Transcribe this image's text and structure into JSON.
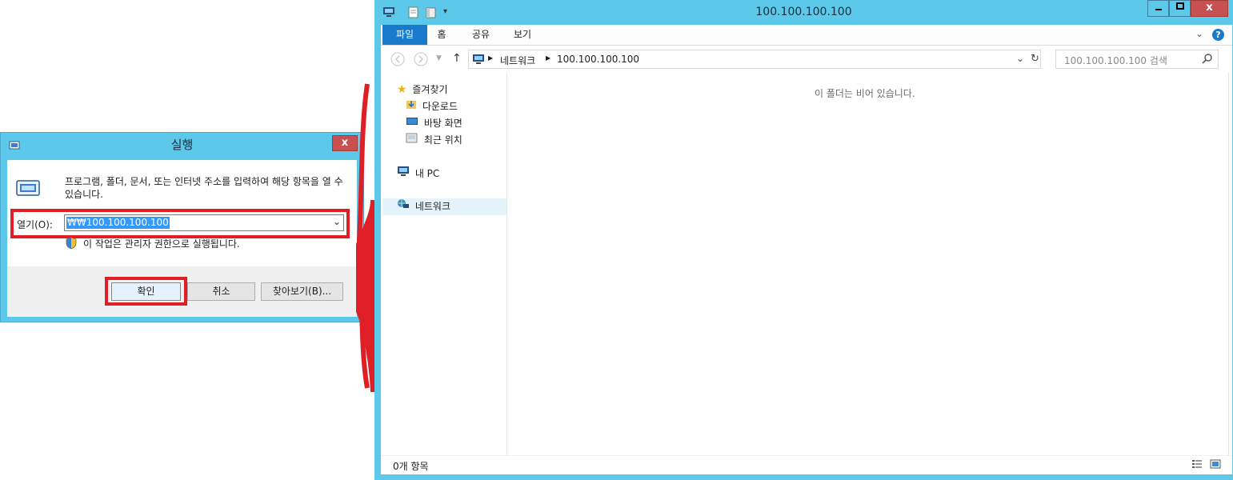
{
  "run_dialog": {
    "title": "실행",
    "close_glyph": "x",
    "message": "프로그램, 폴더, 문서, 또는 인터넷 주소를 입력하여 해당 항목을 열 수 있습니다.",
    "open_label": "열기(O):",
    "open_value": "₩₩100.100.100.100",
    "admin_note": "이 작업은 관리자 권한으로 실행됩니다.",
    "buttons": {
      "ok": "확인",
      "cancel": "취소",
      "browse": "찾아보기(B)..."
    }
  },
  "explorer": {
    "title": "100.100.100.100",
    "ribbon_tabs": [
      "파일",
      "홈",
      "공유",
      "보기"
    ],
    "address": {
      "segments": [
        "네트워크",
        "100.100.100.100"
      ]
    },
    "search_placeholder": "100.100.100.100 검색",
    "nav": {
      "favorites": "즐겨찾기",
      "downloads": "다운로드",
      "desktop": "바탕 화면",
      "recent": "최근 위치",
      "this_pc": "내 PC",
      "network": "네트워크"
    },
    "empty_message": "이 폴더는 비어 있습니다.",
    "status_text": "0개 항목"
  },
  "colors": {
    "annotation_red": "#e01e26",
    "window_frame": "#5cc8ea",
    "file_tab": "#1979ca",
    "selection": "#3399ff"
  }
}
